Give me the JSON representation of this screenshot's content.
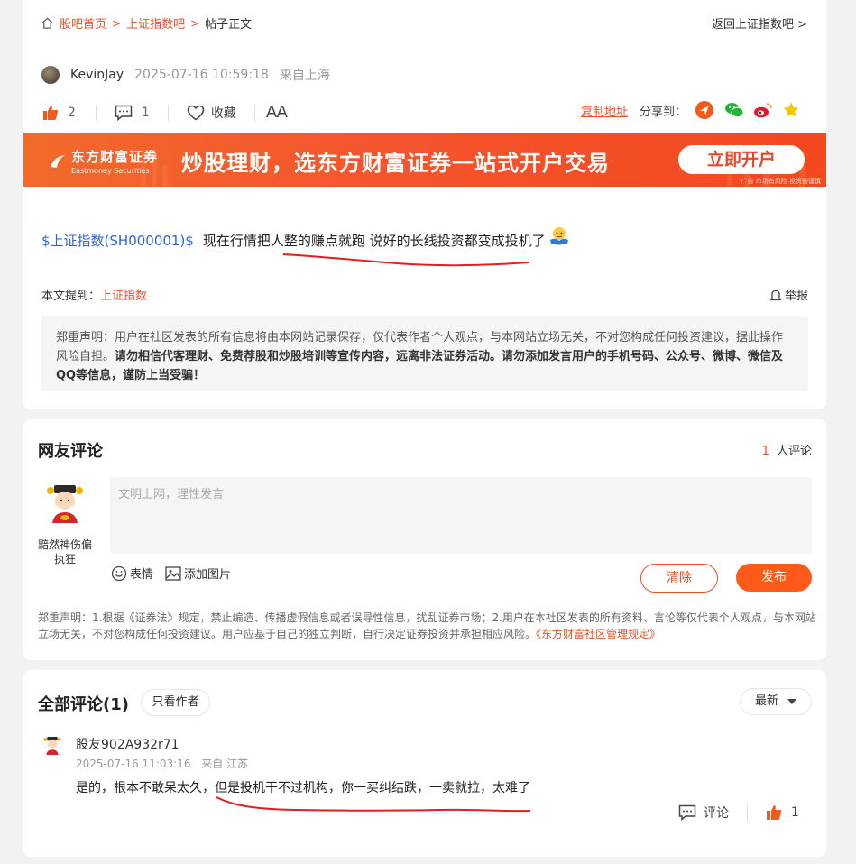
{
  "breadcrumb": {
    "home": "股吧首页",
    "forum": "上证指数吧",
    "current": "帖子正文",
    "back": "返回上证指数吧"
  },
  "post": {
    "author": "KevinJay",
    "time": "2025-07-16 10:59:18",
    "location": "来自上海",
    "likes": "2",
    "comments": "1",
    "favorite": "收藏",
    "font_toggle": "AA",
    "copy_link": "复制地址",
    "share_label": "分享到：",
    "stock_tag": "$上证指数(SH000001)$",
    "content": "现在行情把人整的赚点就跑 说好的长线投资都变成投机了",
    "mention_label": "本文提到：",
    "mention_stock": "上证指数",
    "report": "举报",
    "notice_plain": "郑重声明：用户在社区发表的所有信息将由本网站记录保存，仅代表作者个人观点，与本网站立场无关，不对您构成任何投资建议，据此操作风险自担。",
    "notice_bold": "请勿相信代客理财、免费荐股和炒股培训等宣传内容，远离非法证券活动。请勿添加发言用户的手机号码、公众号、微博、微信及QQ等信息，谨防上当受骗！"
  },
  "banner": {
    "logo_cn": "东方财富证券",
    "logo_en": "Eastmoney Securities",
    "slogan": "炒股理财，选东方财富证券一站式开户交易",
    "cta": "立即开户",
    "ad_tag": "广告 市场有风险 投资需谨慎"
  },
  "comment_box": {
    "title": "网友评论",
    "count": "1",
    "count_suffix": "人评论",
    "username": "黯然神伤偏执狂",
    "placeholder": "文明上网，理性发言",
    "emoji": "表情",
    "add_image": "添加图片",
    "clear": "清除",
    "publish": "发布",
    "notice": "郑重声明：1.根据《证券法》规定，禁止编造、传播虚假信息或者误导性信息，扰乱证券市场；2.用户在本社区发表的所有资料、言论等仅代表个人观点，与本网站立场无关，不对您构成任何投资建议。用户应基于自己的独立判断，自行决定证券投资并承担相应风险。",
    "notice_link": "《东方财富社区管理规定》"
  },
  "all_comments": {
    "title": "全部评论(1)",
    "author_only": "只看作者",
    "sort": "最新",
    "items": [
      {
        "user": "股友902A932r71",
        "time": "2025-07-16 11:03:16",
        "location": "来自 江苏",
        "text": "是的，根本不敢呆太久，但是投机干不过机构，你一买纠结跌，一卖就拉，太难了",
        "reply": "评论",
        "likes": "1"
      }
    ]
  },
  "colors": {
    "accent": "#e8512a",
    "link": "#2f63d6",
    "annotation": "#e02020"
  }
}
